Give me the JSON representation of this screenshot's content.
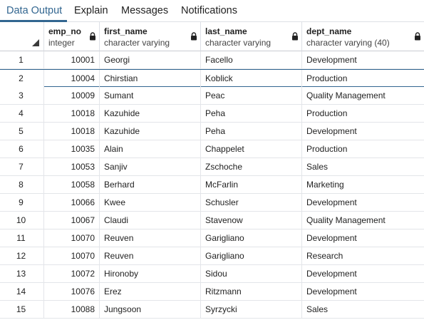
{
  "tabs": [
    {
      "label": "Data Output",
      "active": true
    },
    {
      "label": "Explain",
      "active": false
    },
    {
      "label": "Messages",
      "active": false
    },
    {
      "label": "Notifications",
      "active": false
    }
  ],
  "columns": [
    {
      "name": "emp_no",
      "type": "integer"
    },
    {
      "name": "first_name",
      "type": "character varying"
    },
    {
      "name": "last_name",
      "type": "character varying"
    },
    {
      "name": "dept_name",
      "type": "character varying (40)"
    }
  ],
  "rows": [
    {
      "num": "1",
      "emp_no": "10001",
      "first_name": "Georgi",
      "last_name": "Facello",
      "dept_name": "Development"
    },
    {
      "num": "2",
      "emp_no": "10004",
      "first_name": "Chirstian",
      "last_name": "Koblick",
      "dept_name": "Production"
    },
    {
      "num": "3",
      "emp_no": "10009",
      "first_name": "Sumant",
      "last_name": "Peac",
      "dept_name": "Quality Management"
    },
    {
      "num": "4",
      "emp_no": "10018",
      "first_name": "Kazuhide",
      "last_name": "Peha",
      "dept_name": "Production"
    },
    {
      "num": "5",
      "emp_no": "10018",
      "first_name": "Kazuhide",
      "last_name": "Peha",
      "dept_name": "Development"
    },
    {
      "num": "6",
      "emp_no": "10035",
      "first_name": "Alain",
      "last_name": "Chappelet",
      "dept_name": "Production"
    },
    {
      "num": "7",
      "emp_no": "10053",
      "first_name": "Sanjiv",
      "last_name": "Zschoche",
      "dept_name": "Sales"
    },
    {
      "num": "8",
      "emp_no": "10058",
      "first_name": "Berhard",
      "last_name": "McFarlin",
      "dept_name": "Marketing"
    },
    {
      "num": "9",
      "emp_no": "10066",
      "first_name": "Kwee",
      "last_name": "Schusler",
      "dept_name": "Development"
    },
    {
      "num": "10",
      "emp_no": "10067",
      "first_name": "Claudi",
      "last_name": "Stavenow",
      "dept_name": "Quality Management"
    },
    {
      "num": "11",
      "emp_no": "10070",
      "first_name": "Reuven",
      "last_name": "Garigliano",
      "dept_name": "Development"
    },
    {
      "num": "12",
      "emp_no": "10070",
      "first_name": "Reuven",
      "last_name": "Garigliano",
      "dept_name": "Research"
    },
    {
      "num": "13",
      "emp_no": "10072",
      "first_name": "Hironoby",
      "last_name": "Sidou",
      "dept_name": "Development"
    },
    {
      "num": "14",
      "emp_no": "10076",
      "first_name": "Erez",
      "last_name": "Ritzmann",
      "dept_name": "Development"
    },
    {
      "num": "15",
      "emp_no": "10088",
      "first_name": "Jungsoon",
      "last_name": "Syrzycki",
      "dept_name": "Sales"
    }
  ],
  "selected_row": "2",
  "colors": {
    "accent": "#326690",
    "grid_line": "#e3e5e9"
  }
}
